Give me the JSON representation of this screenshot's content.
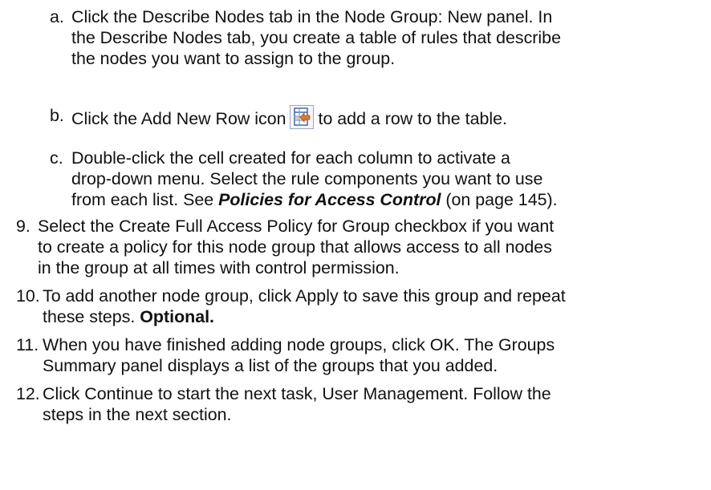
{
  "step_a": {
    "marker": "a.",
    "line1": "Click the Describe Nodes tab in the Node Group: New panel. In",
    "line2": "the Describe Nodes tab, you create a table of rules that describe",
    "line3": "the nodes you want to assign to the group."
  },
  "step_b": {
    "marker": "b.",
    "text_before": "Click the Add New Row icon",
    "text_after": "to add a row to the table.",
    "icon": "add-new-row-icon"
  },
  "step_c": {
    "marker": "c.",
    "line1": "Double-click the cell created for each column to activate a",
    "line2": "drop-down menu. Select the rule components you want to use",
    "line3_before": "from each list. See ",
    "line3_link": "Policies for Access Control",
    "line3_after": " (on page 145)."
  },
  "step_9": {
    "marker": "9.",
    "line1": "Select the Create Full Access Policy for Group checkbox if you want",
    "line2": "to create a policy for this node group that allows access to all nodes",
    "line3": "in the group at all times with control permission."
  },
  "step_10": {
    "marker": "10.",
    "line1": "To add another node group, click Apply to save this group and repeat",
    "line2_before": "these steps. ",
    "line2_bold": "Optional."
  },
  "step_11": {
    "marker": "11.",
    "line1": "When you have finished adding node groups, click OK. The Groups",
    "line2": "Summary panel displays a list of the groups that you added."
  },
  "step_12": {
    "marker": "12.",
    "line1": "Click Continue to start the next task, User Management. Follow the",
    "line2": "steps in the next section."
  },
  "colors": {
    "text": "#111111",
    "icon_border": "#3a5f9e",
    "icon_grid": "#6fa0d8",
    "icon_arrow": "#e0782a"
  }
}
